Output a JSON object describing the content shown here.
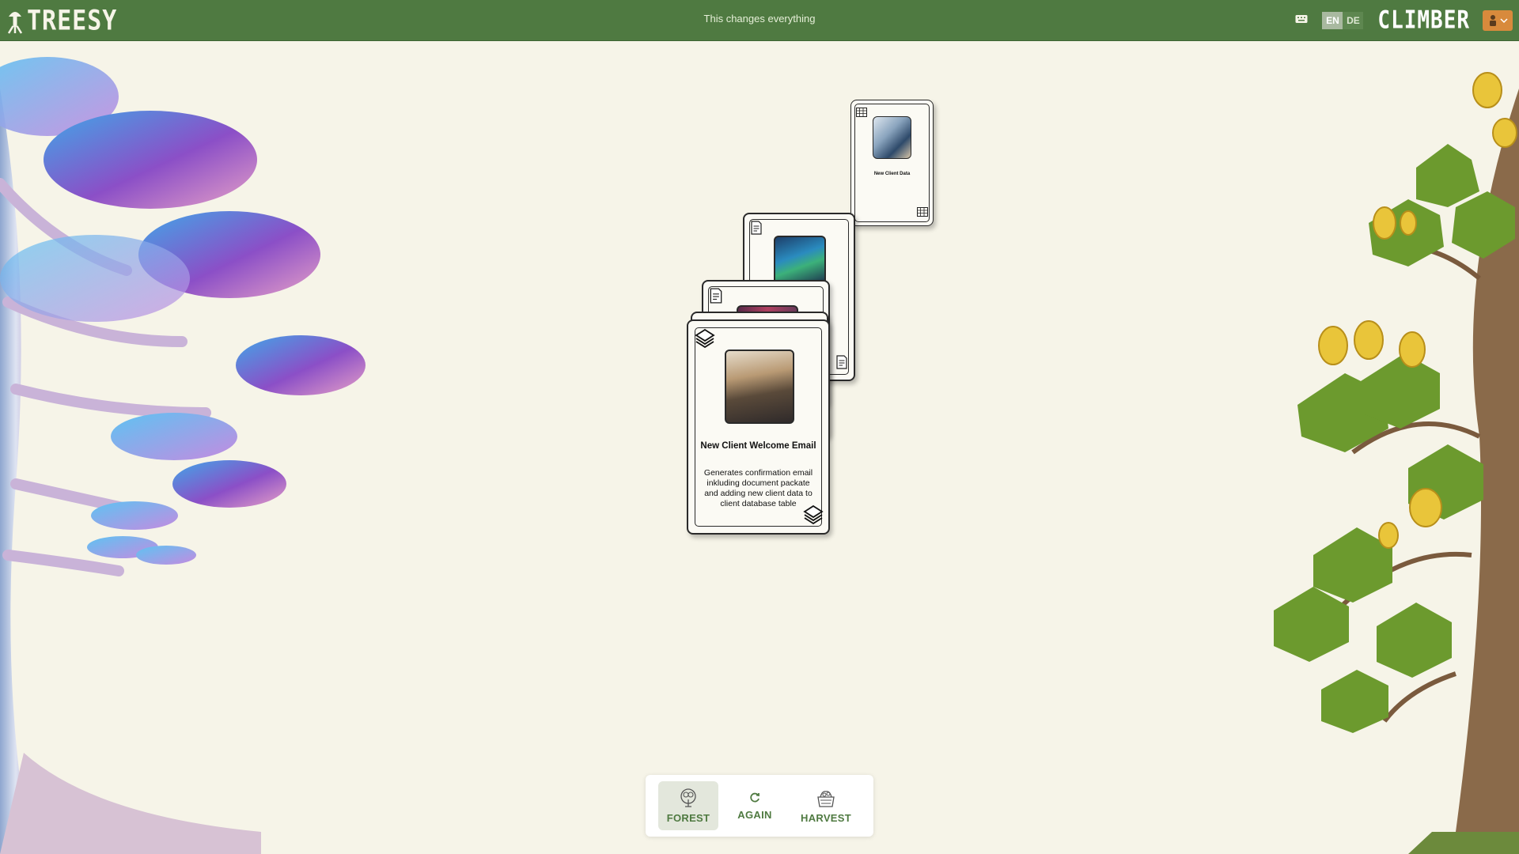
{
  "header": {
    "logo_text": "TREESY",
    "tagline": "This changes everything",
    "keyboard_icon": "keyboard-icon",
    "languages": [
      {
        "code": "EN",
        "active": true
      },
      {
        "code": "DE",
        "active": false
      }
    ],
    "brand": "CLIMBER",
    "user_icon": "user-avatar-icon"
  },
  "cards": {
    "top": {
      "title": "New Client Data",
      "icon": "table-icon"
    },
    "middle": {
      "icon": "document-icon"
    },
    "third": {
      "icon": "document-icon"
    },
    "front": {
      "title": "New Client Welcome Email",
      "description": "Generates confirmation email inkluding document packate and adding new client data to client database table",
      "icon": "layers-icon"
    }
  },
  "toolbar": {
    "items": [
      {
        "label": "FOREST",
        "icon": "forest-icon",
        "active": true
      },
      {
        "label": "AGAIN",
        "icon": "refresh-icon",
        "active": false
      },
      {
        "label": "HARVEST",
        "icon": "harvest-basket-icon",
        "active": false
      }
    ]
  },
  "colors": {
    "header_bg": "#4f7a41",
    "page_bg": "#f6f4e8",
    "accent": "#4f7a41",
    "user_button": "#d88a3c"
  }
}
